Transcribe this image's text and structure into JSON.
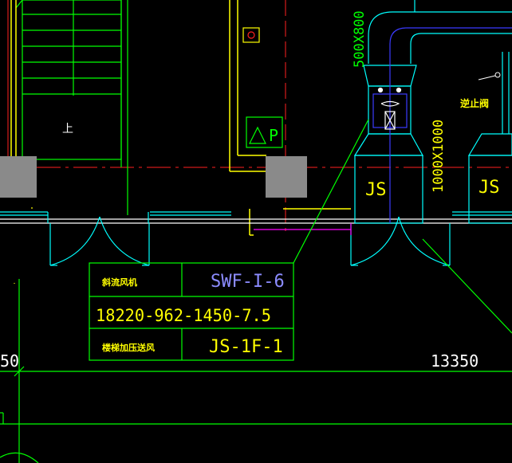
{
  "colors": {
    "background": "#000000",
    "green": "#00ff00",
    "yellow": "#ffff00",
    "cyan": "#00ffff",
    "blue": "#3b3bff",
    "red": "#ff2020",
    "magenta": "#ff00ff",
    "white": "#ffffff",
    "gray_block": "#8a8a8a",
    "lavender_text": "#8c8cff"
  },
  "labels": {
    "stair_up": "上",
    "pressure_symbol": "P",
    "duct_size_vertical": "500X800",
    "duct_size_vertical_2": "1000X1000",
    "valve_label": "逆止阀",
    "shaft_left": "JS",
    "shaft_right": "JS",
    "dim_left_partial": "50",
    "dim_right": "13350"
  },
  "table": {
    "row1_label": "斜流风机",
    "row1_value": "SWF-I-6",
    "row2_spec": "18220-962-1450-7.5",
    "row3_label": "楼梯加压送风",
    "row3_value": "JS-1F-1"
  }
}
